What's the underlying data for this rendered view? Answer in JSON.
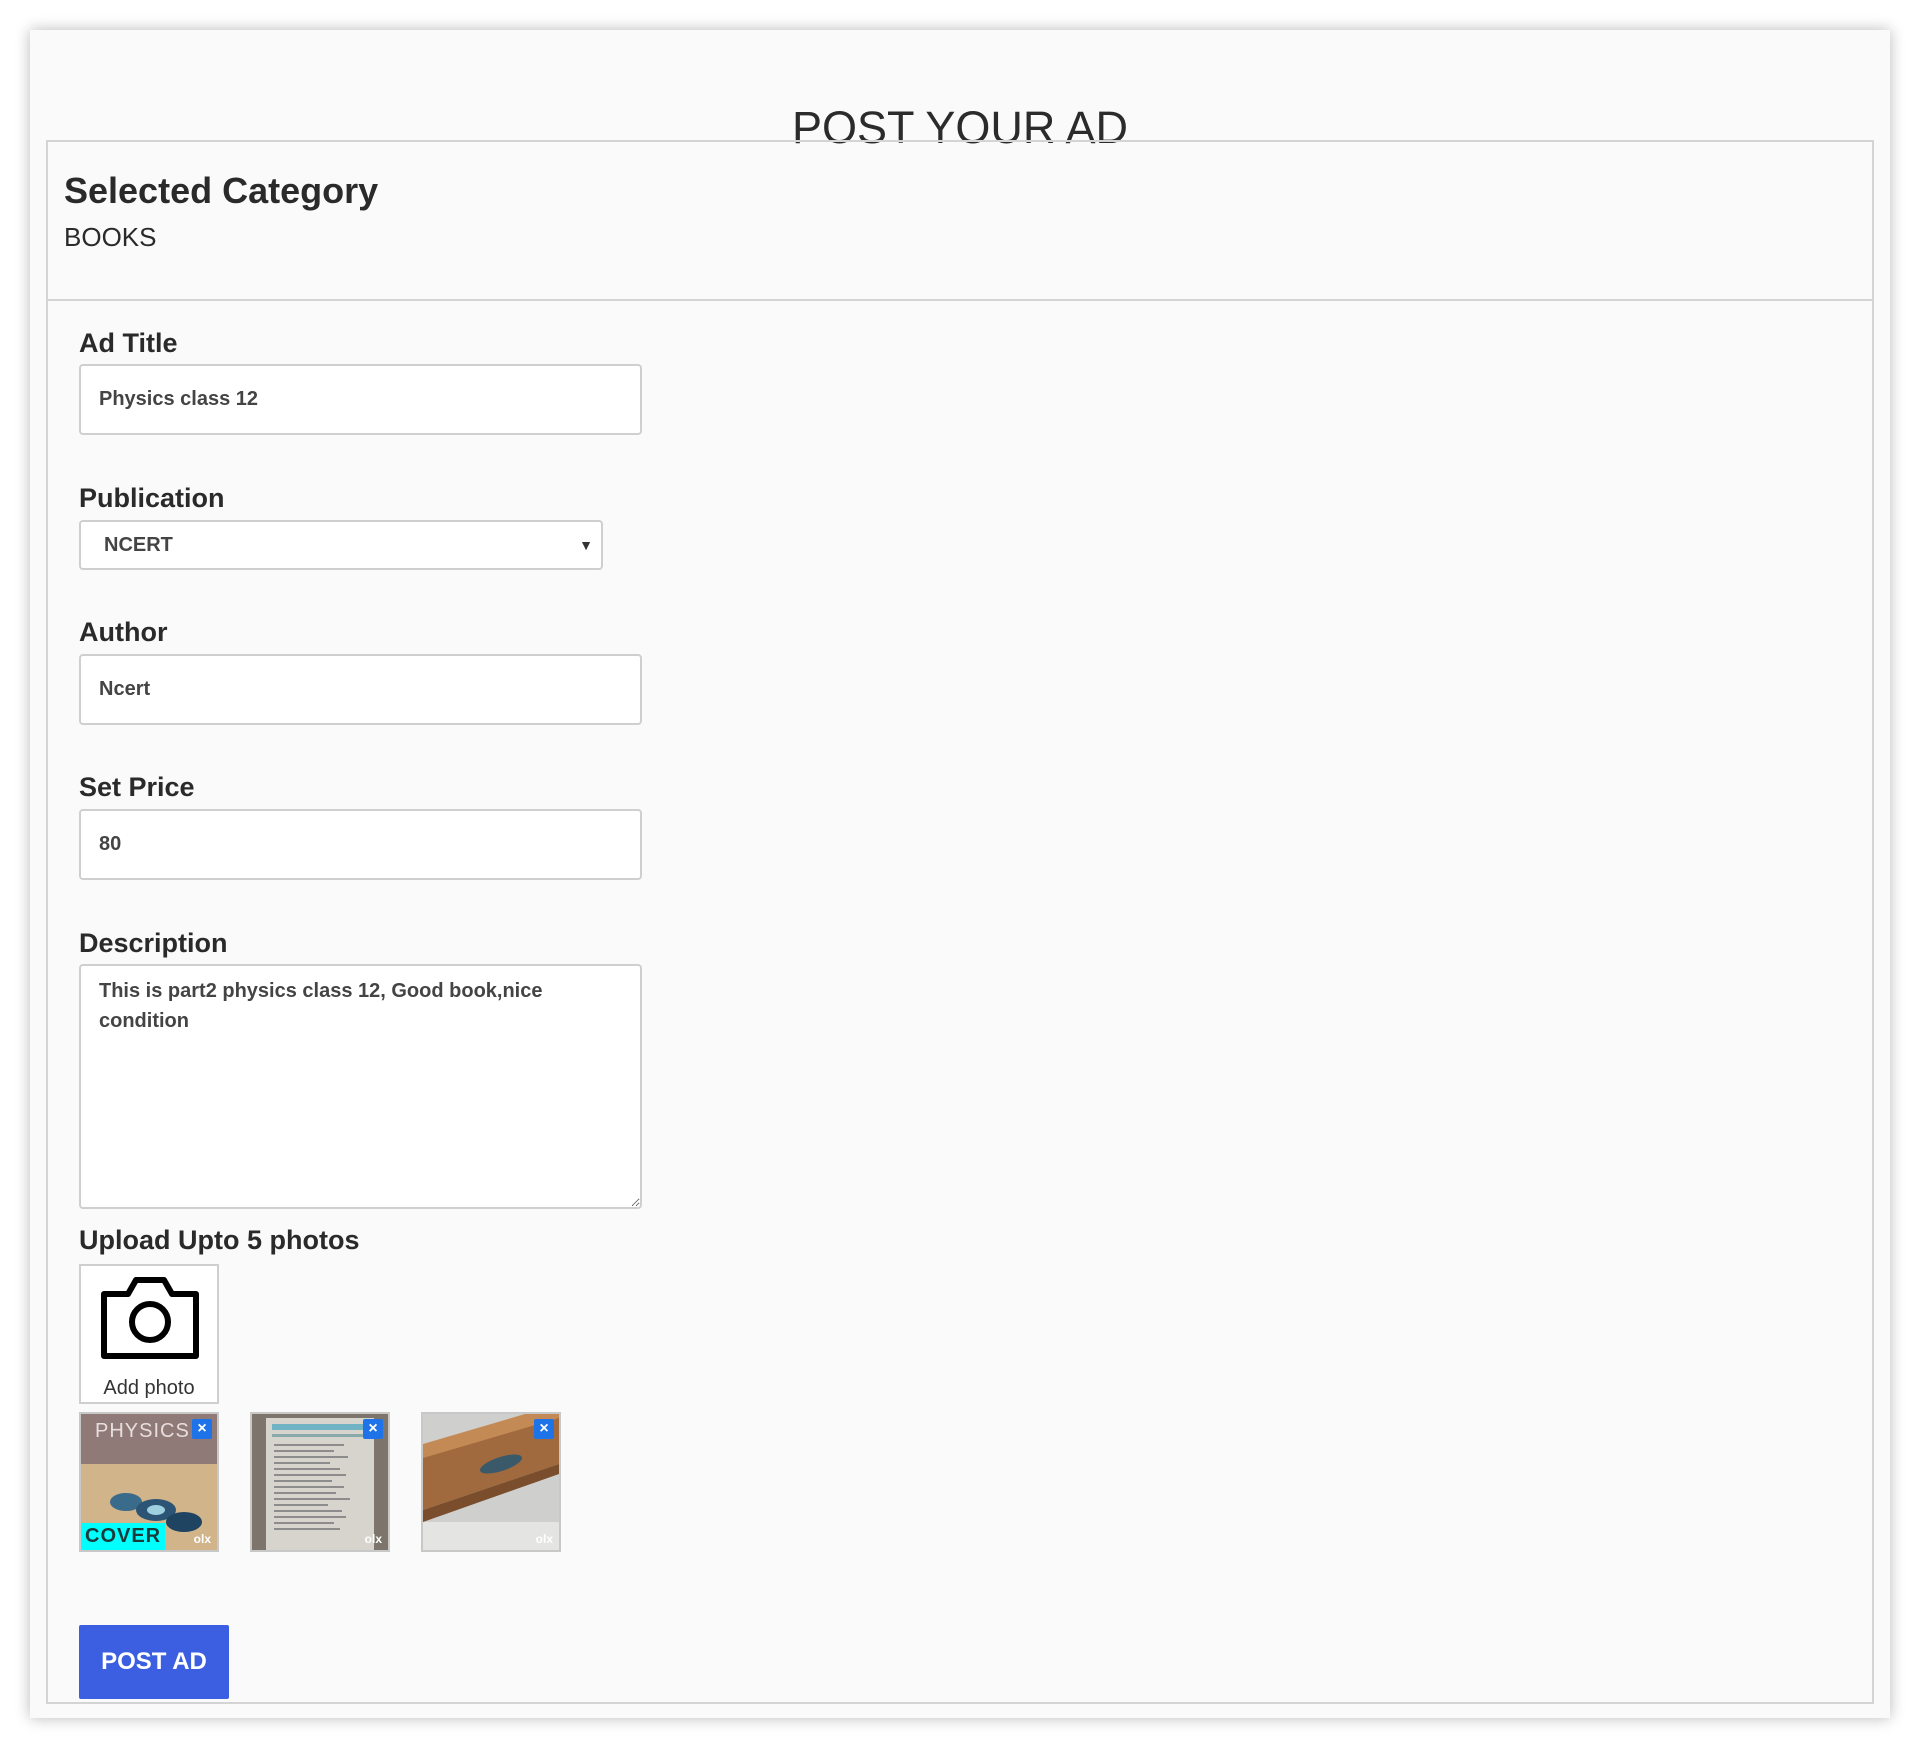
{
  "page": {
    "title": "POST YOUR AD"
  },
  "category": {
    "heading": "Selected Category",
    "value": "BOOKS"
  },
  "form": {
    "ad_title": {
      "label": "Ad Title",
      "value": "Physics class 12"
    },
    "publication": {
      "label": "Publication",
      "value": "NCERT"
    },
    "author": {
      "label": "Author",
      "value": "Ncert"
    },
    "price": {
      "label": "Set Price",
      "value": "80"
    },
    "description": {
      "label": "Description",
      "value": "This is part2 physics class 12, Good book,nice condition"
    },
    "photos": {
      "label": "Upload Upto 5 photos",
      "add_label": "Add photo",
      "cover_label": "COVER",
      "remove_symbol": "×",
      "watermark": "olx",
      "cover_text": "PHYSICS"
    },
    "submit_label": "POST AD"
  },
  "colors": {
    "button": "#3b5fe0",
    "remove": "#1e73e8",
    "cover_badge": "#00ffff"
  },
  "icons": {
    "add_photo": "camera-icon",
    "remove": "close-icon",
    "select": "chevron-down-icon"
  }
}
